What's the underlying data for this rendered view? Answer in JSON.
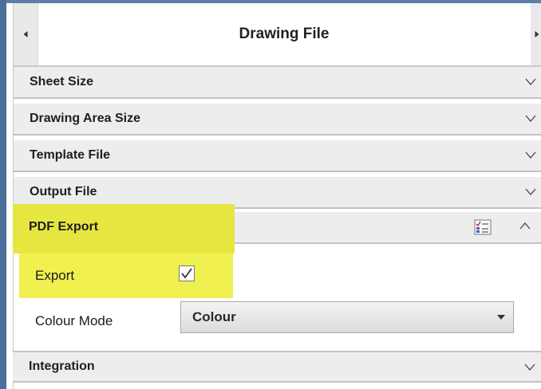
{
  "panel": {
    "title": "Drawing File"
  },
  "sections": [
    {
      "label": "Sheet Size",
      "state": "collapsed"
    },
    {
      "label": "Drawing Area Size",
      "state": "collapsed"
    },
    {
      "label": "Template File",
      "state": "collapsed"
    },
    {
      "label": "Output File",
      "state": "collapsed"
    },
    {
      "label": "PDF Export",
      "state": "expanded"
    },
    {
      "label": "Integration",
      "state": "collapsed"
    }
  ],
  "pdf_export": {
    "export_label": "Export",
    "export_checked": true,
    "colour_mode_label": "Colour Mode",
    "colour_mode_value": "Colour"
  },
  "icons": {
    "nav_left": "chevron-left-icon",
    "nav_right": "chevron-right-icon",
    "collapse": "chevron-down-icon",
    "expand": "chevron-up-icon",
    "list": "checklist-icon"
  },
  "colors": {
    "highlight": "#e6e641",
    "section_bg": "#ededed",
    "frame": "#4a6f9a"
  }
}
